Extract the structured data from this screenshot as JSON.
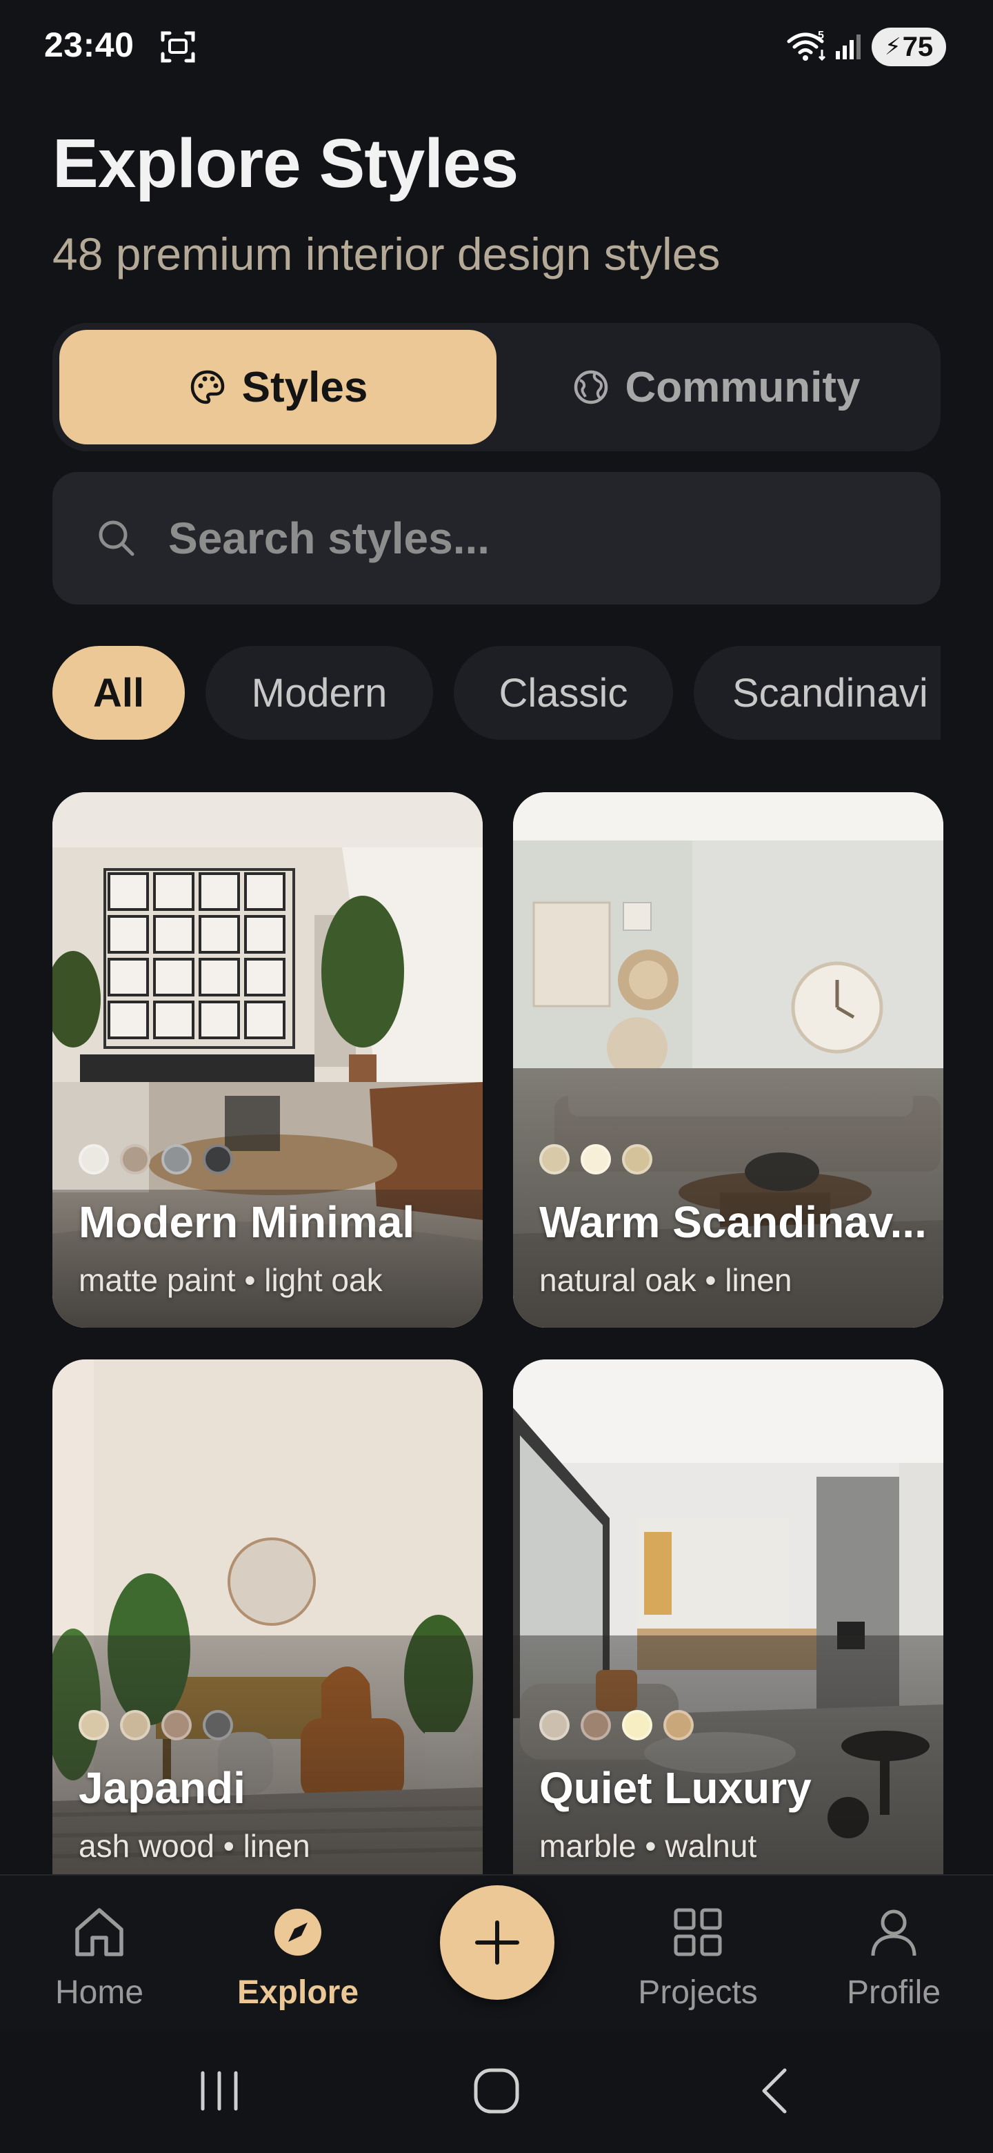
{
  "status_bar": {
    "time": "23:40",
    "battery": "75"
  },
  "header": {
    "title": "Explore Styles",
    "subtitle": "48 premium interior design styles"
  },
  "segmented": {
    "styles_label": "Styles",
    "community_label": "Community"
  },
  "search": {
    "placeholder": "Search styles..."
  },
  "chips": [
    "All",
    "Modern",
    "Classic",
    "Scandinavi"
  ],
  "cards": [
    {
      "title": "Modern Minimal",
      "subtitle": "matte paint • light oak",
      "swatches": [
        "#ece9e2",
        "#b09c8a",
        "#8f9396",
        "#3c3d3f"
      ]
    },
    {
      "title": "Warm Scandinav...",
      "subtitle": "natural oak • linen",
      "swatches": [
        "#d8c9a8",
        "#f7efd7",
        "#d3c29a"
      ]
    },
    {
      "title": "Japandi",
      "subtitle": "ash wood • linen",
      "swatches": [
        "#d8c8a8",
        "#cbb89b",
        "#a88e7a",
        "#5f5f60"
      ]
    },
    {
      "title": "Quiet Luxury",
      "subtitle": "marble • walnut",
      "swatches": [
        "#cdbfae",
        "#9e8470",
        "#f7eec3",
        "#c9a77b"
      ]
    }
  ],
  "bottom_nav": {
    "home": "Home",
    "explore": "Explore",
    "projects": "Projects",
    "profile": "Profile"
  },
  "accent_color": "#ebc896"
}
